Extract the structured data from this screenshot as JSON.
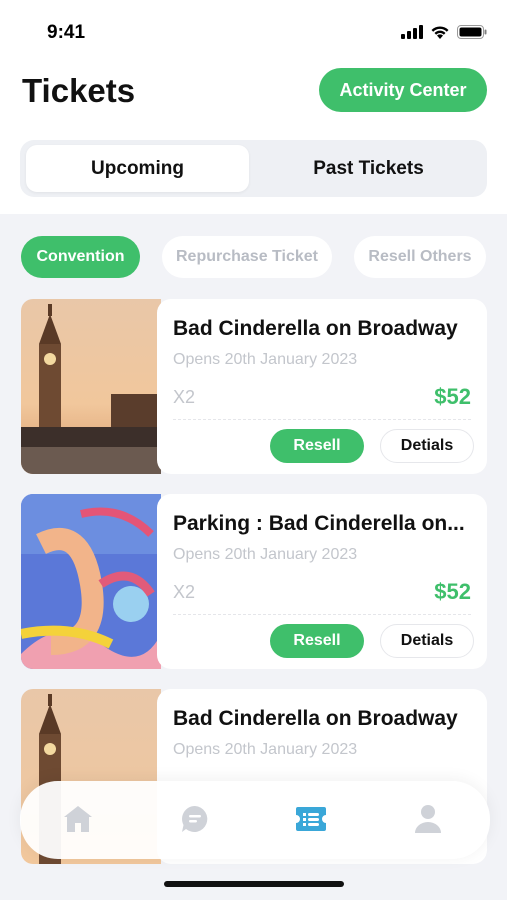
{
  "status_bar": {
    "time": "9:41"
  },
  "header": {
    "title": "Tickets",
    "activity_button": "Activity Center"
  },
  "segments": {
    "active": "Upcoming",
    "inactive": "Past Tickets"
  },
  "chips": [
    "Convention",
    "Repurchase Ticket",
    "Resell Others"
  ],
  "tickets": [
    {
      "title": "Bad Cinderella on Broadway",
      "date": "Opens 20th January 2023",
      "qty": "X2",
      "price": "$52",
      "resell": "Resell",
      "details": "Detials"
    },
    {
      "title": "Parking : Bad Cinderella on...",
      "date": "Opens 20th January 2023",
      "qty": "X2",
      "price": "$52",
      "resell": "Resell",
      "details": "Detials"
    },
    {
      "title": "Bad Cinderella on Broadway",
      "date": "Opens 20th January 2023"
    }
  ],
  "tabbar": {
    "active_tab": "tickets",
    "icons": [
      "home-icon",
      "chat-icon",
      "ticket-icon",
      "profile-icon"
    ]
  },
  "colors": {
    "accent": "#3fbf6b",
    "tab_active": "#3aa7d8",
    "tab_idle": "#cfd2d8",
    "muted_text": "#c3c6cc"
  }
}
